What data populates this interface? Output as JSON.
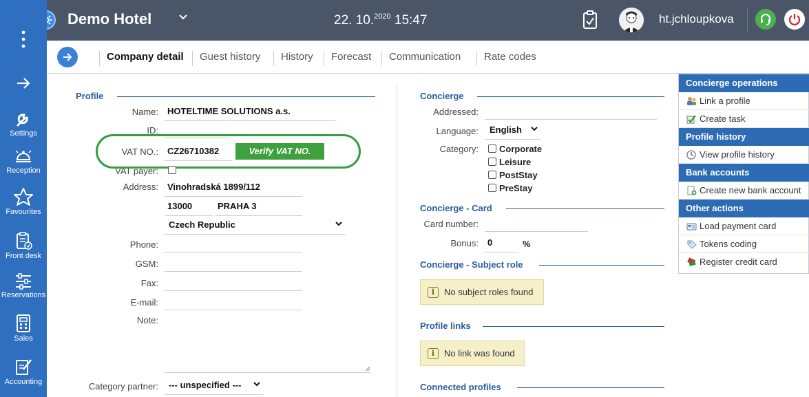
{
  "header": {
    "hotel_name": "Demo Hotel",
    "date_main": "22. 10.",
    "date_year": "2020",
    "time": "15:47",
    "username": "ht.jchloupkova"
  },
  "rail": {
    "items": [
      {
        "label": "Settings",
        "icon": "wrench-icon"
      },
      {
        "label": "Reception",
        "icon": "bell-icon"
      },
      {
        "label": "Favourites",
        "icon": "star-icon"
      },
      {
        "label": "Front desk",
        "icon": "clipboard-icon"
      },
      {
        "label": "Reservations",
        "icon": "sliders-icon"
      },
      {
        "label": "Sales",
        "icon": "calculator-icon"
      },
      {
        "label": "Accounting",
        "icon": "document-pen-icon"
      }
    ]
  },
  "tabs": [
    {
      "label": "Company detail",
      "active": true
    },
    {
      "label": "Guest history"
    },
    {
      "label": "History"
    },
    {
      "label": "Forecast"
    },
    {
      "label": "Communication"
    },
    {
      "label": "Rate codes"
    }
  ],
  "profile": {
    "section_title": "Profile",
    "name_label": "Name:",
    "name_value": "HOTELTIME SOLUTIONS a.s.",
    "id_label": "ID:",
    "vat_label": "VAT NO.:",
    "vat_value": "CZ26710382",
    "verify_label": "Verify VAT NO.",
    "vat_payer_label": "VAT payer:",
    "address_label": "Address:",
    "street": "Vinohradská 1899/112",
    "zip": "13000",
    "city": "PRAHA 3",
    "country": "Czech Republic",
    "phone_label": "Phone:",
    "gsm_label": "GSM:",
    "fax_label": "Fax:",
    "email_label": "E-mail:",
    "note_label": "Note:",
    "category_partner_label": "Category partner:",
    "category_partner_value": "--- unspecified ---"
  },
  "concierge": {
    "section_title": "Concierge",
    "addressed_label": "Addressed:",
    "language_label": "Language:",
    "language_value": "English",
    "category_label": "Category:",
    "categories": [
      "Corporate",
      "Leisure",
      "PostStay",
      "PreStay"
    ],
    "card_title": "Concierge - Card",
    "card_number_label": "Card number:",
    "bonus_label": "Bonus:",
    "bonus_value": "0",
    "bonus_unit": "%",
    "subject_role_title": "Concierge - Subject role",
    "no_subject_roles": "No subject roles found",
    "profile_links_title": "Profile links",
    "no_link": "No link was found",
    "connected_profiles_title": "Connected profiles"
  },
  "right_panel": {
    "concierge_ops": "Concierge operations",
    "link_profile": "Link a profile",
    "create_task": "Create task",
    "profile_history": "Profile history",
    "view_profile_history": "View profile history",
    "bank_accounts": "Bank accounts",
    "create_bank_account": "Create new bank account",
    "other_actions": "Other actions",
    "load_payment_card": "Load payment card",
    "tokens_coding": "Tokens coding",
    "register_credit_card": "Register credit card"
  },
  "colors": {
    "topbar": "#4a5568",
    "rail": "#2f6fbf",
    "accent": "#2a5d9f",
    "verify_green": "#3ea13e",
    "highlight_green": "#2fa043"
  }
}
